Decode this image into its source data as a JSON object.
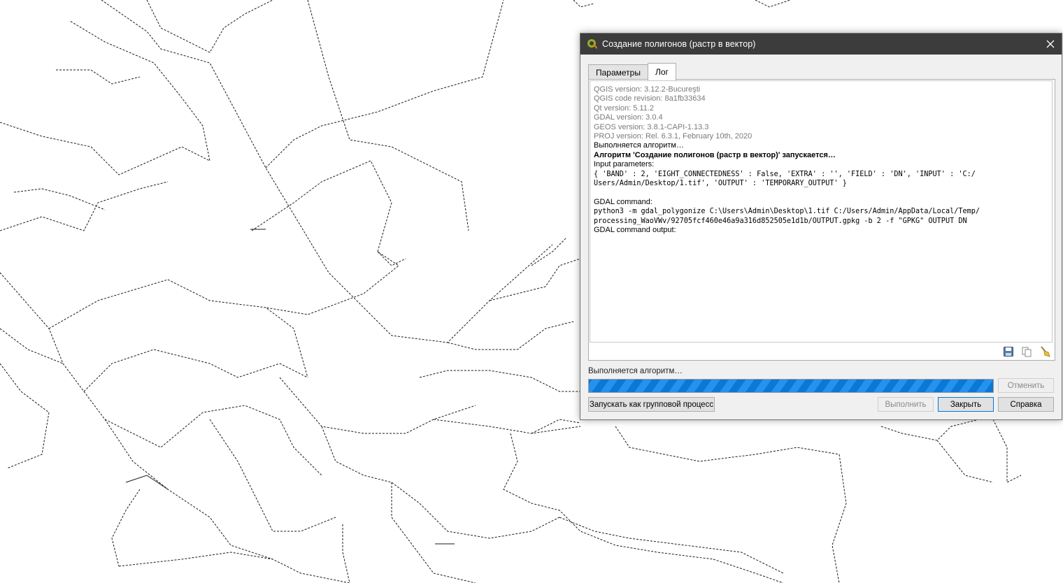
{
  "window": {
    "title": "Создание полигонов (растр в вектор)",
    "icon": "qgis-logo-icon"
  },
  "tabs": [
    {
      "label": "Параметры",
      "active": false
    },
    {
      "label": "Лог",
      "active": true
    }
  ],
  "log": {
    "lines": [
      {
        "text": "QGIS version: 3.12.2-Bucureşti",
        "style": "gray"
      },
      {
        "text": "QGIS code revision: 8a1fb33634",
        "style": "gray"
      },
      {
        "text": "Qt version: 5.11.2",
        "style": "gray"
      },
      {
        "text": "GDAL version: 3.0.4",
        "style": "gray"
      },
      {
        "text": "GEOS version: 3.8.1-CAPI-1.13.3",
        "style": "gray"
      },
      {
        "text": "PROJ version: Rel. 6.3.1, February 10th, 2020",
        "style": "gray"
      },
      {
        "text": "Выполняется алгоритм…",
        "style": "normal"
      },
      {
        "text": "Алгоритм 'Создание полигонов (растр в вектор)' запускается…",
        "style": "bold"
      },
      {
        "text": "Input parameters:",
        "style": "normal"
      },
      {
        "text": "{ 'BAND' : 2, 'EIGHT_CONNECTEDNESS' : False, 'EXTRA' : '', 'FIELD' : 'DN', 'INPUT' : 'C:/",
        "style": "mono"
      },
      {
        "text": "Users/Admin/Desktop/1.tif', 'OUTPUT' : 'TEMPORARY_OUTPUT' }",
        "style": "mono"
      },
      {
        "text": "",
        "style": "normal"
      },
      {
        "text": "GDAL command:",
        "style": "normal"
      },
      {
        "text": "python3 -m gdal_polygonize C:\\Users\\Admin\\Desktop\\1.tif C:/Users/Admin/AppData/Local/Temp/",
        "style": "mono"
      },
      {
        "text": "processing_WaoVWv/92705fcf460e46a9a316d852505e1d1b/OUTPUT.gpkg -b 2 -f \"GPKG\" OUTPUT DN",
        "style": "mono"
      },
      {
        "text": "GDAL command output:",
        "style": "normal"
      }
    ],
    "tools": [
      "save-icon",
      "copy-icon",
      "clear-broom-icon"
    ]
  },
  "status": {
    "text": "Выполняется алгоритм…",
    "progress_percent": 100
  },
  "buttons": {
    "cancel": "Отменить",
    "batch": "Запускать как групповой процесс",
    "run": "Выполнить",
    "close": "Закрыть",
    "help": "Справка"
  },
  "colors": {
    "titlebar": "#3c3c3c",
    "progress": "#0a78d7",
    "default_button_border": "#0078d7"
  }
}
